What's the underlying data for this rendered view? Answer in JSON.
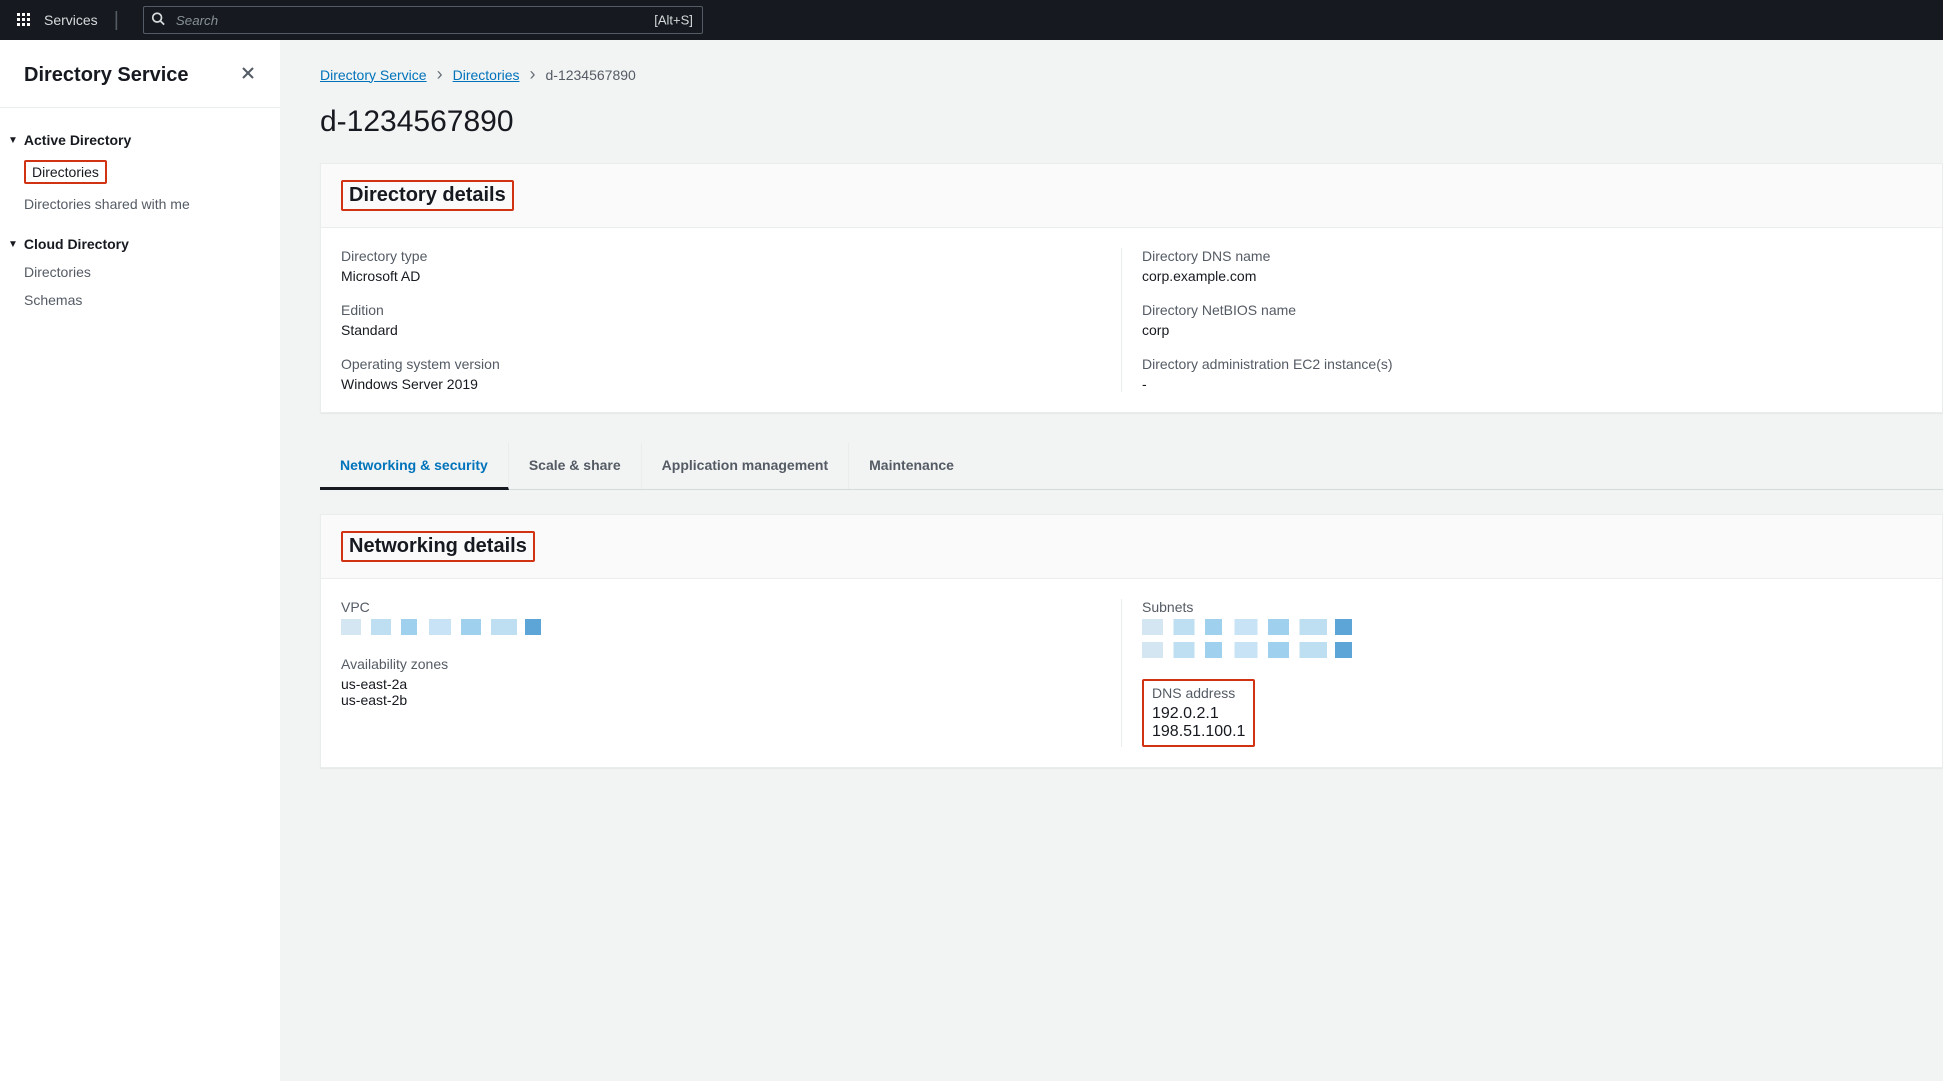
{
  "topnav": {
    "services_label": "Services",
    "search_placeholder": "Search",
    "search_shortcut": "[Alt+S]"
  },
  "sidebar": {
    "title": "Directory Service",
    "groups": [
      {
        "title": "Active Directory",
        "items": [
          {
            "label": "Directories",
            "active": true
          },
          {
            "label": "Directories shared with me",
            "active": false
          }
        ]
      },
      {
        "title": "Cloud Directory",
        "items": [
          {
            "label": "Directories",
            "active": false
          },
          {
            "label": "Schemas",
            "active": false
          }
        ]
      }
    ]
  },
  "breadcrumbs": {
    "items": [
      {
        "label": "Directory Service",
        "link": true
      },
      {
        "label": "Directories",
        "link": true
      },
      {
        "label": "d-1234567890",
        "link": false
      }
    ]
  },
  "page_title": "d-1234567890",
  "directory_details": {
    "panel_title": "Directory details",
    "left": {
      "directory_type_label": "Directory type",
      "directory_type_value": "Microsoft AD",
      "edition_label": "Edition",
      "edition_value": "Standard",
      "os_version_label": "Operating system version",
      "os_version_value": "Windows Server 2019"
    },
    "right": {
      "dns_name_label": "Directory DNS name",
      "dns_name_value": "corp.example.com",
      "netbios_label": "Directory NetBIOS name",
      "netbios_value": "corp",
      "ec2_label": "Directory administration EC2 instance(s)",
      "ec2_value": "-"
    }
  },
  "tabs": {
    "items": [
      "Networking & security",
      "Scale & share",
      "Application management",
      "Maintenance"
    ],
    "active_index": 0
  },
  "networking_details": {
    "panel_title": "Networking details",
    "vpc_label": "VPC",
    "az_label": "Availability zones",
    "az_values": [
      "us-east-2a",
      "us-east-2b"
    ],
    "subnets_label": "Subnets",
    "dns_addr_label": "DNS address",
    "dns_addr_values": [
      "192.0.2.1",
      "198.51.100.1"
    ]
  }
}
